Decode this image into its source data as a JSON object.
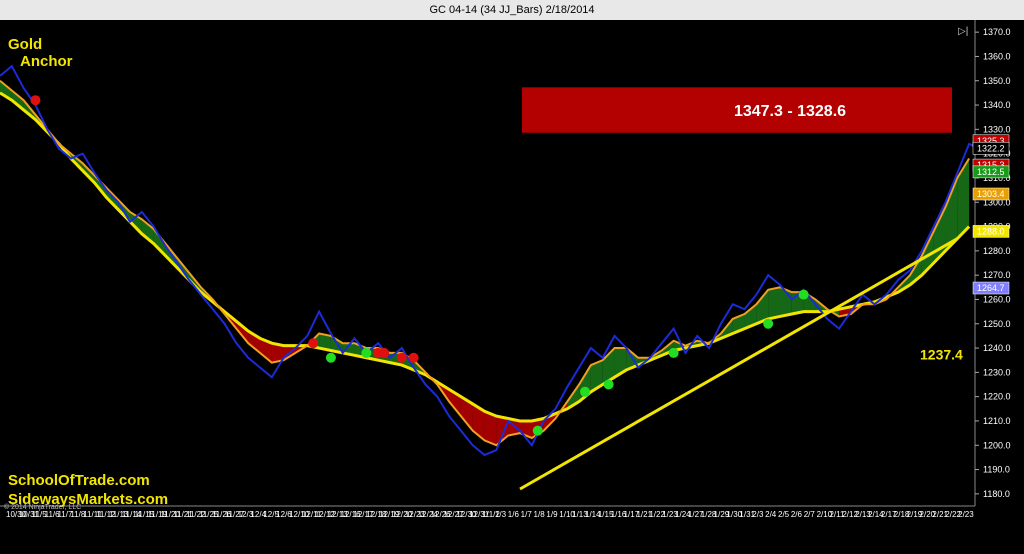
{
  "title": "GC 04-14 (34 JJ_Bars)  2/18/2014",
  "labels": {
    "gold": "Gold",
    "anchor": "Anchor",
    "target_level": "1237.4"
  },
  "target_box": {
    "text": "1347.3 - 1328.6",
    "low": 1328.6,
    "high": 1347.3,
    "color": "#b30000"
  },
  "branding": [
    "SchoolOfTrade.com",
    "SidewaysMarkets.com"
  ],
  "copyright": "© 2014 NinjaTrader, LLC",
  "colors": {
    "bg": "#000000",
    "up": "#1a7a1a",
    "down": "#c00000",
    "anchor": "#f2e600",
    "price": "#1c2bd8",
    "box": "#6a6aff"
  },
  "chart_data": {
    "type": "line",
    "ylim": [
      1175,
      1375
    ],
    "y_ticks": [
      1180,
      1190,
      1200,
      1210,
      1220,
      1230,
      1240,
      1250,
      1260,
      1270,
      1280,
      1290,
      1300,
      1310,
      1320,
      1330,
      1340,
      1350,
      1360,
      1370
    ],
    "y_tick_labels": [
      "1180.0",
      "1190.0",
      "1200.0",
      "1210.0",
      "1220.0",
      "1230.0",
      "1240.0",
      "1250.0",
      "1260.0",
      "1270.0",
      "1280.0",
      "1290.0",
      "1300.0",
      "1310.0",
      "1320.0",
      "1330.0",
      "1340.0",
      "1350.0",
      "1360.0",
      "1370.0"
    ],
    "x_tick_labels": [
      "10/30",
      "10/31",
      "11/5",
      "11/6",
      "11/7",
      "11/8",
      "11/11",
      "11/12",
      "11/13",
      "11/14",
      "11/15",
      "11/19",
      "11/20",
      "11/21",
      "11/22",
      "11/25",
      "11/26",
      "11/27",
      "12/3",
      "12/4",
      "12/5",
      "12/6",
      "12/10",
      "12/11",
      "12/12",
      "12/13",
      "12/16",
      "12/17",
      "12/18",
      "12/19",
      "12/20",
      "12/23",
      "12/24",
      "12/26",
      "12/27",
      "12/30",
      "12/31",
      "1/1/2",
      "1/3",
      "1/6",
      "1/7",
      "1/8",
      "1/9",
      "1/10",
      "1/13",
      "1/14",
      "1/15",
      "1/16",
      "1/17",
      "1/21",
      "1/22",
      "1/23",
      "1/24",
      "1/27",
      "1/28",
      "1/29",
      "1/30",
      "1/31",
      "2/3",
      "2/4",
      "2/5",
      "2/6",
      "2/7",
      "2/10",
      "2/11",
      "2/12",
      "2/13",
      "2/14",
      "2/17",
      "2/18",
      "2/19",
      "2/20",
      "2/21",
      "2/22",
      "2/23"
    ],
    "x_index": [
      0,
      4,
      8,
      12,
      16,
      20,
      24,
      28,
      32,
      36,
      40,
      44,
      48,
      52,
      56,
      60,
      64,
      68,
      72,
      76,
      80,
      84,
      88,
      92,
      96,
      100
    ],
    "price": [
      1352,
      1356,
      1347,
      1340,
      1330,
      1322,
      1318,
      1320,
      1312,
      1305,
      1300,
      1292,
      1296,
      1290,
      1282,
      1275,
      1268,
      1262,
      1256,
      1250,
      1242,
      1236,
      1232,
      1228,
      1236,
      1240,
      1245,
      1255,
      1246,
      1238,
      1244,
      1238,
      1242,
      1236,
      1240,
      1232,
      1225,
      1220,
      1212,
      1206,
      1200,
      1196,
      1198,
      1210,
      1206,
      1200,
      1210,
      1215,
      1224,
      1232,
      1240,
      1236,
      1245,
      1240,
      1232,
      1236,
      1242,
      1248,
      1238,
      1245,
      1240,
      1250,
      1258,
      1256,
      1262,
      1270,
      1266,
      1260,
      1264,
      1258,
      1252,
      1248,
      1255,
      1262,
      1258,
      1262,
      1268,
      1272,
      1280,
      1290,
      1300,
      1312,
      1324,
      1322
    ],
    "anchor": [
      1345,
      1342,
      1338,
      1334,
      1329,
      1324,
      1318,
      1313,
      1308,
      1302,
      1297,
      1292,
      1287,
      1283,
      1278,
      1273,
      1268,
      1263,
      1259,
      1255,
      1251,
      1247,
      1244,
      1242,
      1241,
      1241,
      1241,
      1240,
      1239,
      1238,
      1237,
      1236,
      1235,
      1234,
      1233,
      1231,
      1229,
      1226,
      1223,
      1220,
      1217,
      1214,
      1212,
      1211,
      1210,
      1210,
      1211,
      1213,
      1215,
      1218,
      1222,
      1225,
      1228,
      1231,
      1233,
      1235,
      1237,
      1239,
      1240,
      1241,
      1242,
      1244,
      1246,
      1248,
      1250,
      1252,
      1253,
      1254,
      1255,
      1255,
      1255,
      1256,
      1257,
      1258,
      1259,
      1261,
      1263,
      1266,
      1270,
      1275,
      1280,
      1285,
      1290
    ],
    "fast_ma": [
      1350,
      1346,
      1342,
      1336,
      1330,
      1324,
      1320,
      1316,
      1311,
      1306,
      1301,
      1296,
      1293,
      1289,
      1283,
      1277,
      1271,
      1265,
      1260,
      1254,
      1248,
      1242,
      1238,
      1234,
      1235,
      1238,
      1241,
      1246,
      1245,
      1242,
      1242,
      1240,
      1240,
      1238,
      1238,
      1235,
      1230,
      1225,
      1218,
      1212,
      1206,
      1202,
      1200,
      1204,
      1205,
      1203,
      1206,
      1211,
      1218,
      1225,
      1233,
      1235,
      1240,
      1240,
      1236,
      1236,
      1239,
      1243,
      1241,
      1243,
      1242,
      1246,
      1252,
      1254,
      1258,
      1264,
      1265,
      1263,
      1263,
      1260,
      1256,
      1253,
      1254,
      1258,
      1258,
      1260,
      1265,
      1270,
      1278,
      1288,
      1298,
      1310,
      1318
    ],
    "trendline": {
      "x": [
        88,
        162
      ],
      "y": [
        1182,
        1285
      ]
    },
    "markers_up": [
      [
        56,
        1236
      ],
      [
        62,
        1238
      ],
      [
        91,
        1206
      ],
      [
        99,
        1222
      ],
      [
        103,
        1225
      ],
      [
        114,
        1238
      ],
      [
        130,
        1250
      ],
      [
        136,
        1262
      ]
    ],
    "markers_down": [
      [
        6,
        1342
      ],
      [
        53,
        1242
      ],
      [
        64,
        1238
      ],
      [
        65,
        1238
      ],
      [
        68,
        1236
      ],
      [
        70,
        1236
      ]
    ],
    "price_tags": [
      {
        "label": "1325.3",
        "value": 1325.3,
        "color": "#c00000"
      },
      {
        "label": "1322.2",
        "value": 1322.2,
        "color": "#000000"
      },
      {
        "label": "1315.3",
        "value": 1315.3,
        "color": "#c00000"
      },
      {
        "label": "1312.5",
        "value": 1312.5,
        "color": "#1a9a1a"
      },
      {
        "label": "1303.4",
        "value": 1303.4,
        "color": "#e8a000"
      },
      {
        "label": "1288.0",
        "value": 1288.0,
        "color": "#f2e600"
      },
      {
        "label": "1264.7",
        "value": 1264.7,
        "color": "#8080ff"
      }
    ],
    "grid": false
  }
}
